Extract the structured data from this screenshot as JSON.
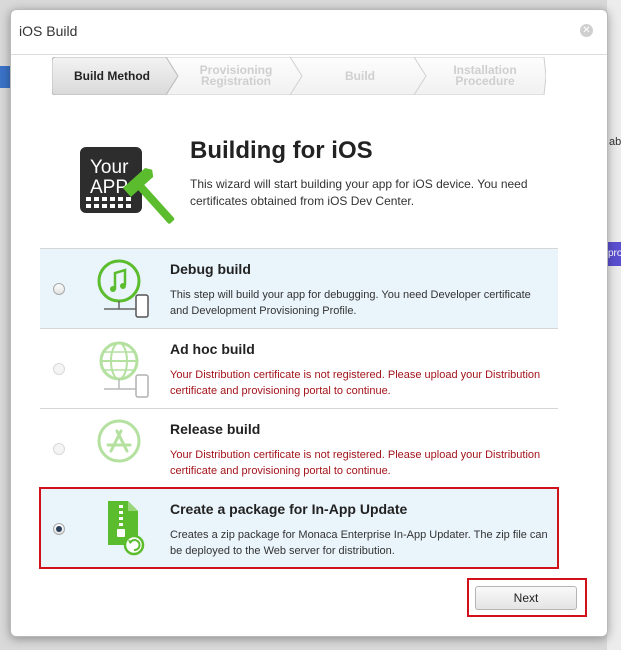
{
  "background": {
    "right_text": "ab",
    "right_button": "pro"
  },
  "dialog": {
    "title": "iOS Build",
    "close_glyph": "✕"
  },
  "steps": [
    {
      "label_1": "Build Method",
      "label_2": "",
      "active": true
    },
    {
      "label_1": "Provisioning",
      "label_2": "Registration",
      "active": false
    },
    {
      "label_1": "Build",
      "label_2": "",
      "active": false
    },
    {
      "label_1": "Installation",
      "label_2": "Procedure",
      "active": false
    }
  ],
  "hero": {
    "logo_line_1": "Your",
    "logo_line_2": "APP",
    "title": "Building for iOS",
    "description": "This wizard will start building your app for iOS device. You need certificates obtained from iOS Dev Center."
  },
  "options": [
    {
      "title": "Debug build",
      "description": "This step will build your app for debugging. You need Developer certificate and Development Provisioning Profile.",
      "enabled": true,
      "checked": false,
      "icon": "music-note-icon"
    },
    {
      "title": "Ad hoc build",
      "description": "Your Distribution certificate is not registered. Please upload your Distribution certificate and provisioning portal to continue.",
      "enabled": false,
      "checked": false,
      "icon": "globe-icon"
    },
    {
      "title": "Release build",
      "description": "Your Distribution certificate is not registered. Please upload your Distribution certificate and provisioning portal to continue.",
      "enabled": false,
      "checked": false,
      "icon": "app-store-icon"
    },
    {
      "title": "Create a package for In-App Update",
      "description": "Creates a zip package for Monaca Enterprise In-App Updater. The zip file can be deployed to the Web server for distribution.",
      "enabled": true,
      "checked": true,
      "icon": "zip-file-icon"
    }
  ],
  "footer": {
    "next_label": "Next"
  },
  "colors": {
    "accent_green": "#5bbd2e",
    "error_red": "#a3141b",
    "highlight_red": "#d0101b",
    "selected_bg": "#eaf4fb"
  }
}
